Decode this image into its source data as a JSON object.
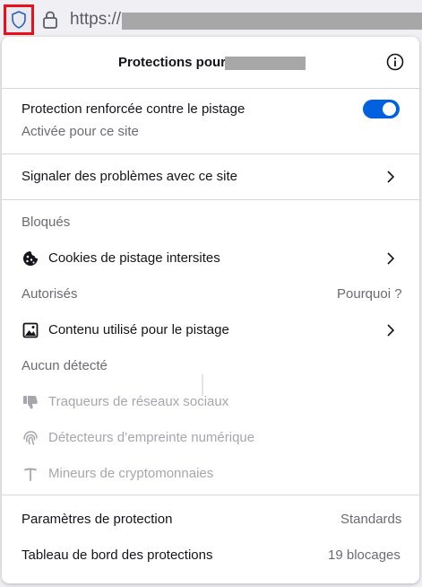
{
  "urlbar": {
    "url_prefix": "https://",
    "shield_icon": "shield-icon",
    "lock_icon": "lock-icon"
  },
  "panel": {
    "title": "Protections pour",
    "info_icon": "info-icon",
    "etp": {
      "label": "Protection renforcée contre le pistage",
      "status": "Activée pour ce site",
      "toggle_on": true
    },
    "report_label": "Signaler des problèmes avec ce site",
    "blocked_heading": "Bloqués",
    "blocked_items": [
      {
        "label": "Cookies de pistage intersites",
        "icon": "cookie-icon"
      }
    ],
    "allowed_heading": "Autorisés",
    "allowed_why": "Pourquoi ?",
    "allowed_items": [
      {
        "label": "Contenu utilisé pour le pistage",
        "icon": "image-icon"
      }
    ],
    "none_heading": "Aucun détecté",
    "none_items": [
      {
        "label": "Traqueurs de réseaux sociaux",
        "icon": "thumbs-down-icon"
      },
      {
        "label": "Détecteurs d’empreinte numérique",
        "icon": "fingerprint-icon"
      },
      {
        "label": "Mineurs de cryptomonnaies",
        "icon": "pickaxe-icon"
      }
    ],
    "footer": {
      "settings_label": "Paramètres de protection",
      "settings_value": "Standards",
      "dashboard_label": "Tableau de bord des protections",
      "dashboard_value": "19 blocages"
    }
  },
  "colors": {
    "accent": "#0060df",
    "highlight_border": "#e8101a",
    "redaction": "#a7a7a7"
  }
}
